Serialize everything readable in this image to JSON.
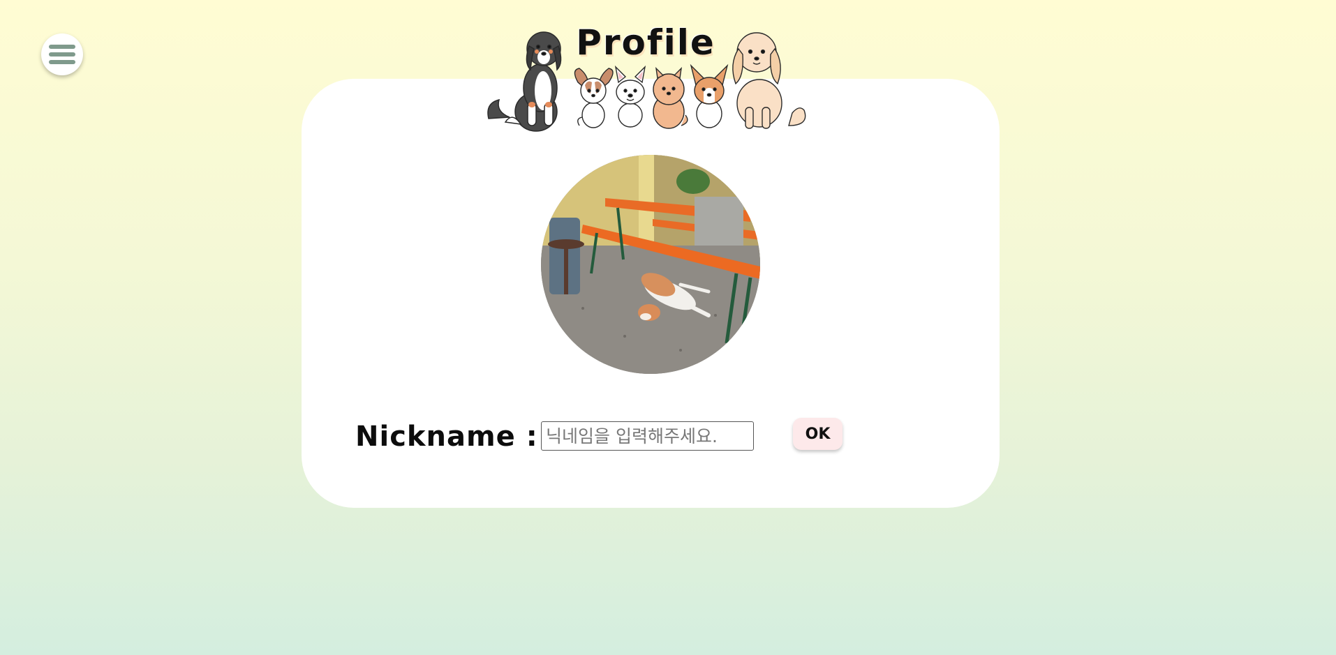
{
  "header": {
    "title": "Profile",
    "menu_icon": "hamburger-menu-icon",
    "banner_art": "row-of-dogs-illustration"
  },
  "profile": {
    "photo": "dog-lying-under-orange-benches-photo",
    "nickname_label": "Nickname :",
    "nickname_placeholder": "닉네임을 입력해주세요.",
    "nickname_value": "",
    "ok_label": "OK"
  },
  "colors": {
    "background_top": "#fffcd3",
    "background_bottom": "#d4eedf",
    "card": "#ffffff",
    "ok_button": "#fde9ea"
  }
}
